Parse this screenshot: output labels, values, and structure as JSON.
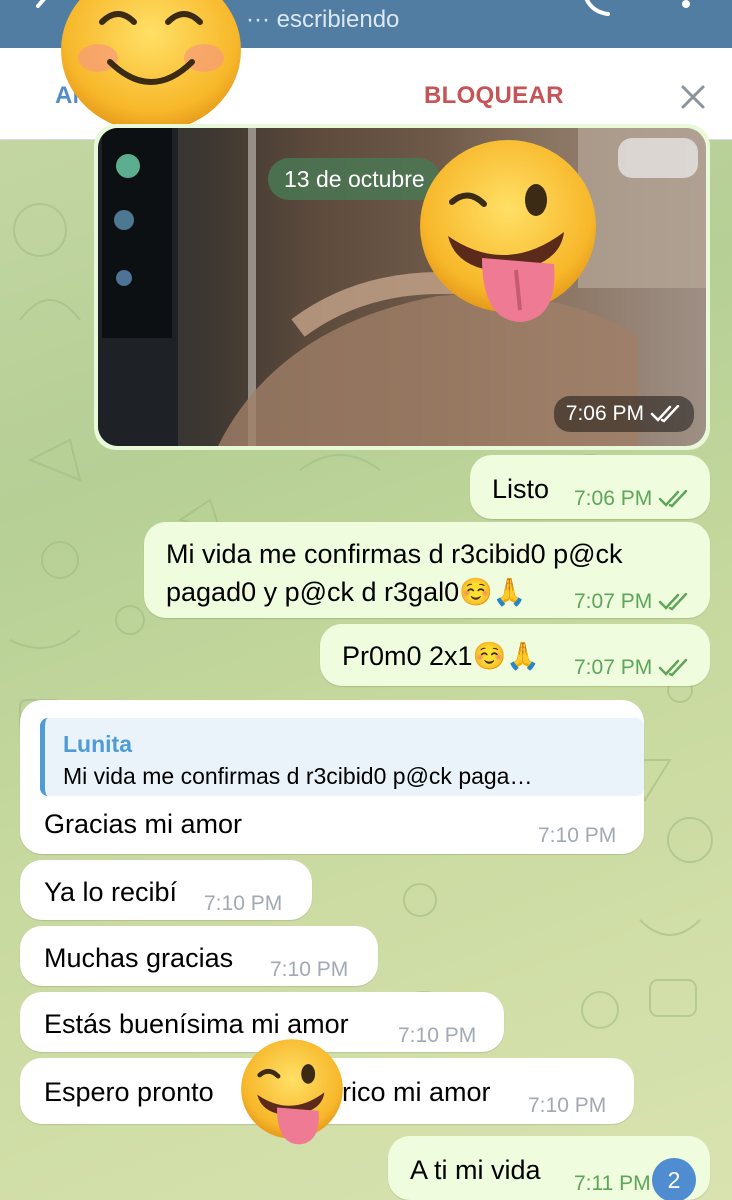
{
  "header": {
    "status": "··· escribiendo"
  },
  "actions": {
    "add_contact": "ANADIR CONTACTO",
    "add_contact_visible": "ANA      TACTO",
    "block": "BLOQUEAR"
  },
  "media": {
    "time": "7:06 PM",
    "date_pill": "13 de octubre"
  },
  "messages": [
    {
      "dir": "out",
      "text": "Listo",
      "time": "7:06 PM"
    },
    {
      "dir": "out",
      "line1": "Mi vida me confirmas d r3cibid0 p@ck",
      "line2": "pagad0 y p@ck d r3gal0☺️🙏",
      "time": "7:07 PM"
    },
    {
      "dir": "out",
      "text": "Pr0m0 2x1☺️🙏",
      "time": "7:07 PM"
    },
    {
      "dir": "in",
      "reply_name": "Lunita",
      "reply_text": "Mi vida me confirmas d r3cibid0 p@ck paga…",
      "text": "Gracias mi amor",
      "time": "7:10 PM"
    },
    {
      "dir": "in",
      "text": "Ya lo recibí",
      "time": "7:10 PM"
    },
    {
      "dir": "in",
      "text": "Muchas gracias",
      "time": "7:10 PM"
    },
    {
      "dir": "in",
      "text": "Estás buenísima mi amor",
      "time": "7:10 PM"
    },
    {
      "dir": "in",
      "text_left": "Espero pronto",
      "text_right": "rico mi amor",
      "time": "7:10 PM"
    },
    {
      "dir": "out",
      "text": "A ti mi vida",
      "time": "7:11 PM"
    }
  ],
  "unread_badge": "2",
  "colors": {
    "header": "#517da2",
    "outgoing_bubble": "#effdde",
    "incoming_bubble": "#ffffff",
    "check_green": "#5ea55a",
    "link_blue": "#4e8ec4",
    "block_red": "#c65356"
  },
  "icons": [
    "back-arrow-icon",
    "phone-icon",
    "more-vert-icon",
    "close-icon",
    "double-check-icon",
    "smiling-face-sticker",
    "winking-tongue-face-sticker"
  ]
}
